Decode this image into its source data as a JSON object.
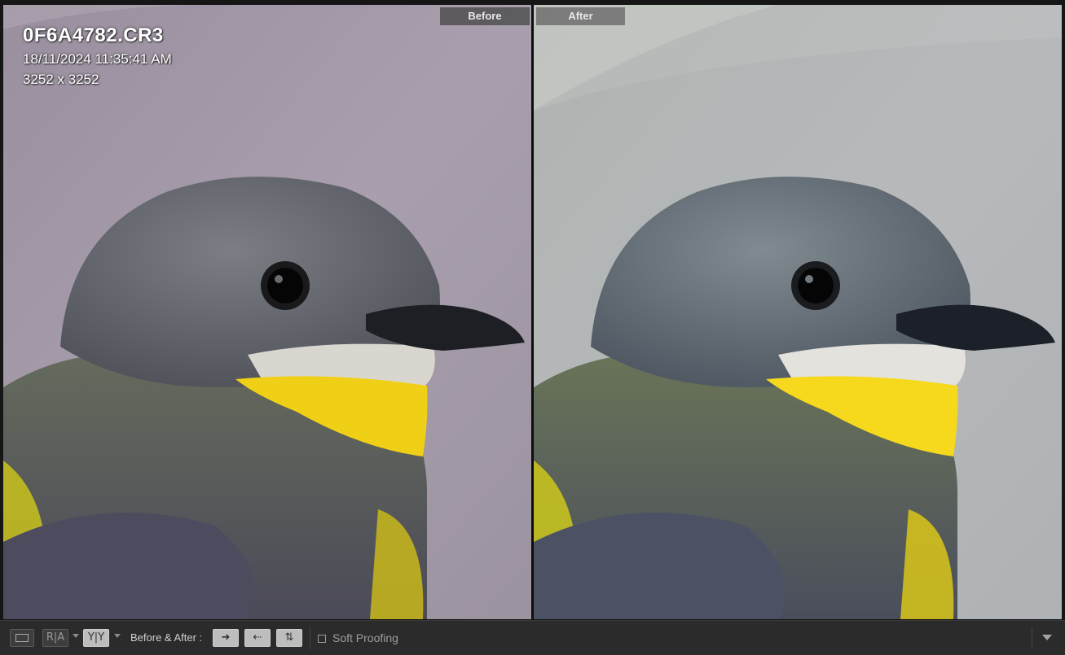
{
  "panes": {
    "before": {
      "label": "Before"
    },
    "after": {
      "label": "After"
    }
  },
  "info": {
    "filename": "0F6A4782.CR3",
    "datetime": "18/11/2024 11:35:41 AM",
    "dimensions": "3252 x 3252"
  },
  "toolbar": {
    "view_loupe_icon": "loupe-view-icon",
    "ra_label": "R|A",
    "yy_label": "Y|Y",
    "before_after_label": "Before & After :",
    "copy_before_to_after_icon": "arrow-right-icon",
    "copy_after_to_before_icon": "arrow-left-icon",
    "swap_icon": "swap-icon",
    "soft_proofing_label": "Soft Proofing",
    "soft_proofing_checked": false,
    "menu_icon": "chevron-down-icon"
  },
  "colors": {
    "before_background": "#a49aa8",
    "after_background": "#b4b7b8",
    "bird_yellow": "#f3d21a",
    "toolbar_bg": "#2b2b2b"
  }
}
